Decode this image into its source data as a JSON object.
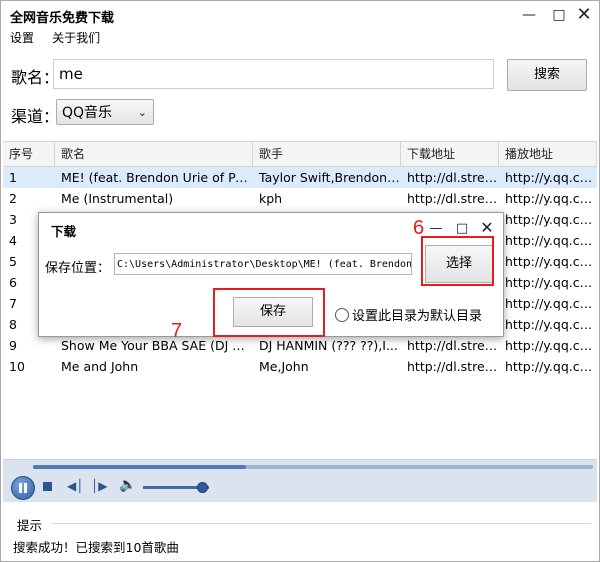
{
  "window": {
    "title": "全网音乐免费下载",
    "controls": {
      "minimize": "—",
      "maximize": "□",
      "close": "✕"
    }
  },
  "menu": [
    {
      "label": "设置"
    },
    {
      "label": "关于我们"
    }
  ],
  "search": {
    "song_label": "歌名：",
    "song_value": "me",
    "button_label": "搜索",
    "channel_label": "渠道：",
    "channel_value": "QQ音乐"
  },
  "table": {
    "columns": [
      "序号",
      "歌名",
      "歌手",
      "下载地址",
      "播放地址"
    ],
    "rows": [
      [
        "1",
        "ME! (feat. Brendon Urie of Pan...",
        "Taylor Swift,Brendon ...",
        "http://dl.strea...",
        "http://y.qq.co..."
      ],
      [
        "2",
        "Me (Instrumental)",
        "kph",
        "http://dl.strea...",
        "http://y.qq.co..."
      ],
      [
        "3",
        "",
        "",
        "",
        "http://y.qq.co..."
      ],
      [
        "4",
        "",
        "",
        "",
        "http://y.qq.co..."
      ],
      [
        "5",
        "",
        "",
        "",
        "http://y.qq.co..."
      ],
      [
        "6",
        "",
        "",
        "",
        "http://y.qq.co..."
      ],
      [
        "7",
        "",
        "",
        "",
        "http://y.qq.co..."
      ],
      [
        "8",
        "",
        "",
        "",
        "http://y.qq.co..."
      ],
      [
        "9",
        "Show Me Your BBA SAE (DJ Br...",
        "DJ HANMIN (??? ??),I...",
        "http://dl.strea...",
        "http://y.qq.co..."
      ],
      [
        "10",
        "Me and John",
        "Me,John",
        "http://dl.strea...",
        "http://y.qq.co..."
      ]
    ],
    "selected_row": 1
  },
  "dialog": {
    "title": "下载",
    "save_location_label": "保存位置：",
    "path_value": "C:\\Users\\Administrator\\Desktop\\ME! (feat. Brendon U",
    "choose_label": "选择",
    "save_label": "保存",
    "default_dir_label": "设置此目录为默认目录",
    "controls": {
      "minimize": "—",
      "maximize": "□",
      "close": "✕"
    }
  },
  "annotations": {
    "step6": "6",
    "step7": "7",
    "color": "#e02020"
  },
  "player": {
    "progress": 0.38,
    "volume": 0.9,
    "icons": [
      "pause-icon",
      "stop-icon",
      "previous-icon",
      "next-icon",
      "volume-icon"
    ]
  },
  "status": {
    "title": "提示",
    "message": "搜索成功！已搜索到10首歌曲"
  }
}
